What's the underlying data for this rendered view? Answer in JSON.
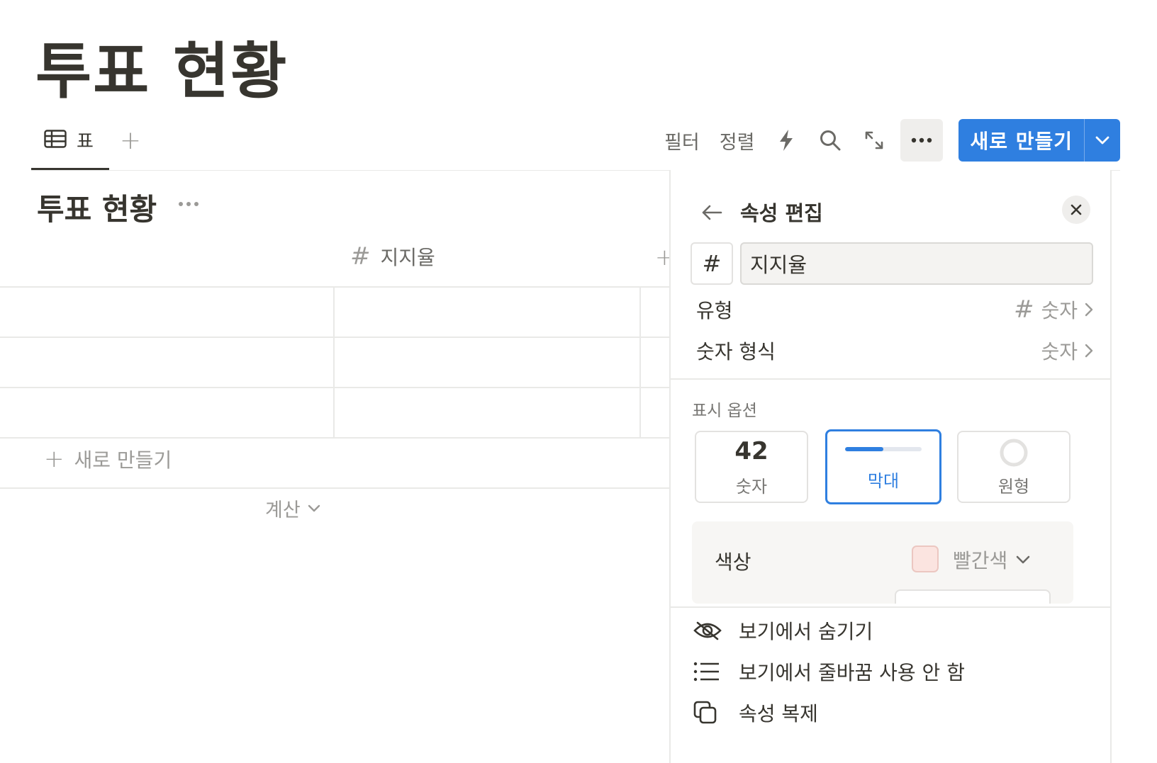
{
  "page": {
    "title": "투표 현황"
  },
  "toolbar": {
    "view_tab_label": "표",
    "filter_label": "필터",
    "sort_label": "정렬",
    "new_button_label": "새로 만들기"
  },
  "table": {
    "view_title": "투표 현황",
    "column_header": "지지율",
    "column_type_symbol": "#",
    "add_row_label": "새로 만들기",
    "calc_label": "계산"
  },
  "panel": {
    "title": "속성 편집",
    "type_symbol": "#",
    "property_name": "지지율",
    "rows": [
      {
        "label": "유형",
        "value_symbol": "#",
        "value": "숫자"
      },
      {
        "label": "숫자 형식",
        "value": "숫자"
      }
    ],
    "display_section_label": "표시 옵션",
    "display_options": [
      {
        "preview": "42",
        "label": "숫자",
        "selected": false
      },
      {
        "label": "막대",
        "selected": true,
        "bar_fill_fraction": 0.5
      },
      {
        "label": "원형",
        "selected": false
      }
    ],
    "color": {
      "label": "색상",
      "value": "빨간색",
      "swatch": "#fbe4e0"
    },
    "menu": [
      {
        "icon": "eye-slash-icon",
        "label": "보기에서 숨기기"
      },
      {
        "icon": "list-icon",
        "label": "보기에서 줄바꿈 사용 안 함"
      },
      {
        "icon": "duplicate-icon",
        "label": "속성 복제"
      }
    ]
  },
  "colors": {
    "accent": "#2f7fe0",
    "text": "#37352f",
    "muted": "#9b9a97"
  }
}
